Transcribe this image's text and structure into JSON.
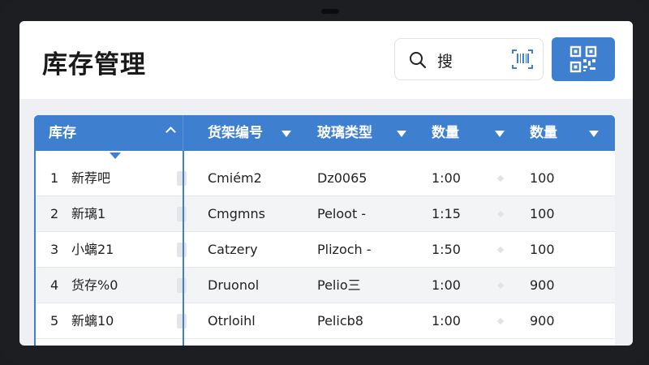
{
  "header": {
    "title": "库存管理",
    "search": {
      "value": "搜"
    }
  },
  "table": {
    "columns": [
      {
        "label": "库存",
        "sort": "up"
      },
      {
        "label": "货架编号",
        "sort": "down"
      },
      {
        "label": "玻璃类型",
        "sort": "down"
      },
      {
        "label": "数量",
        "sort": "down"
      },
      {
        "label": "数量",
        "sort": "down"
      }
    ],
    "rows": [
      {
        "index": "1",
        "name": "新荐吧",
        "shelf": "Cmiém2",
        "glass": "Dz0065",
        "qty1": "1:00",
        "qty2": "100"
      },
      {
        "index": "2",
        "name": "新璃1",
        "shelf": "Cmgmns",
        "glass": "Peloot -",
        "qty1": "1:15",
        "qty2": "100"
      },
      {
        "index": "3",
        "name": "小螭21",
        "shelf": "Catzery",
        "glass": "Plizoch -",
        "qty1": "1:50",
        "qty2": "100"
      },
      {
        "index": "4",
        "name": "货存%0",
        "shelf": "Druonol",
        "glass": "Pelio三",
        "qty1": "1:00",
        "qty2": "900"
      },
      {
        "index": "5",
        "name": "新螭10",
        "shelf": "Otrloihl",
        "glass": "Pelicb8",
        "qty1": "1:00",
        "qty2": "900"
      }
    ]
  },
  "colors": {
    "accent": "#3f7fd0",
    "header_bg": "#ffffff",
    "page_bg": "#eef0f3"
  },
  "icons": [
    "search-icon",
    "barcode-scan-icon",
    "qr-code-icon",
    "sort-up-icon",
    "sort-down-icon"
  ]
}
